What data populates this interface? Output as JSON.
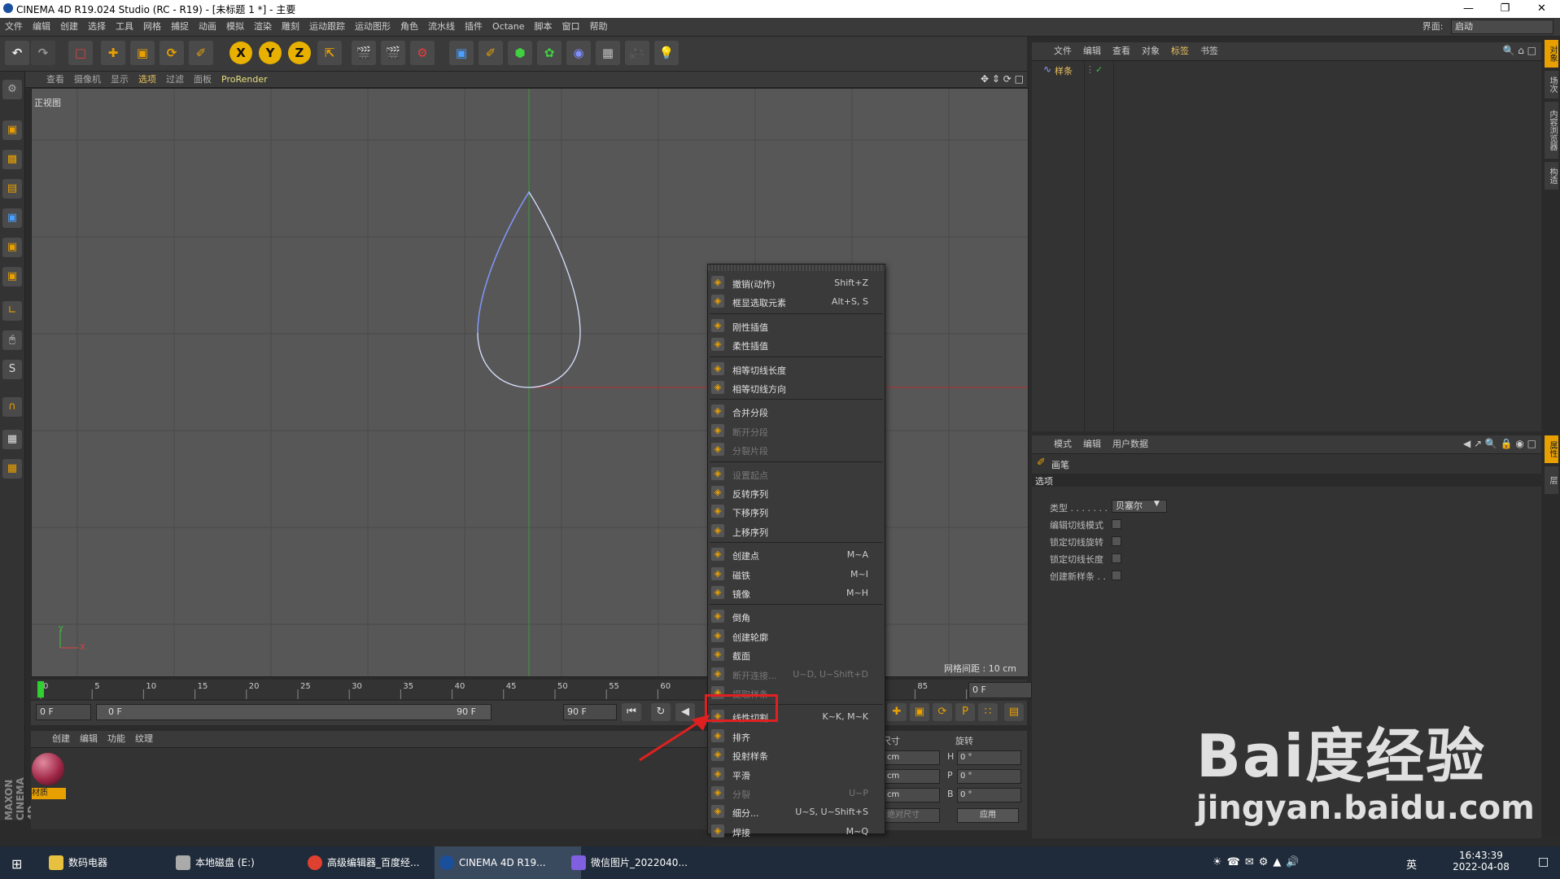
{
  "window": {
    "title": "CINEMA 4D R19.024 Studio (RC - R19) - [未标题 1 *] - 主要",
    "min_icon": "minimize-icon",
    "max_icon": "maximize-icon",
    "close_icon": "close-icon"
  },
  "menubar": {
    "items": [
      "文件",
      "编辑",
      "创建",
      "选择",
      "工具",
      "网格",
      "捕捉",
      "动画",
      "模拟",
      "渲染",
      "雕刻",
      "运动跟踪",
      "运动图形",
      "角色",
      "流水线",
      "插件",
      "Octane",
      "脚本",
      "窗口",
      "帮助"
    ],
    "layout_label": "界面:",
    "layout_value": "启动"
  },
  "toolbar": {
    "axes": [
      "X",
      "Y",
      "Z"
    ]
  },
  "viewport": {
    "menu": [
      "查看",
      "摄像机",
      "显示",
      "选项",
      "过滤",
      "面板",
      "ProRender"
    ],
    "view_name": "正视图",
    "grid_info": "网格间距 : 10 cm",
    "axis_y": "Y",
    "axis_x": "X"
  },
  "timeline": {
    "ticks": [
      "0",
      "5",
      "10",
      "15",
      "20",
      "25",
      "30",
      "35",
      "40",
      "45",
      "50",
      "55",
      "60",
      "65",
      "85",
      "90"
    ],
    "current_frame": "0 F",
    "start": "0 F",
    "range_start": "0 F",
    "range_end": "90 F",
    "end": "90 F"
  },
  "material": {
    "menu": [
      "创建",
      "编辑",
      "功能",
      "纹理"
    ],
    "name": "材质"
  },
  "coords": {
    "size_label": "尺寸",
    "rotation_label": "旋转",
    "rows": [
      {
        "size": "cm",
        "rlabel": "H",
        "rval": "0 °"
      },
      {
        "size": "cm",
        "rlabel": "P",
        "rval": "0 °"
      },
      {
        "size": "cm",
        "rlabel": "B",
        "rval": "0 °"
      }
    ],
    "mode": "绝对尺寸",
    "apply": "应用"
  },
  "object_manager": {
    "menu": [
      "文件",
      "编辑",
      "查看",
      "对象",
      "标签",
      "书签"
    ],
    "object_name": "样条"
  },
  "attributes": {
    "menu": [
      "模式",
      "编辑",
      "用户数据"
    ],
    "tool_name": "画笔",
    "section": "选项",
    "type_label": "类型 . . . . . . .",
    "type_value": "贝塞尔",
    "options": [
      "编辑切线模式",
      "锁定切线旋转",
      "锁定切线长度",
      "创建新样条 . ."
    ]
  },
  "right_strip": [
    "对象",
    "场次",
    "内容浏览器",
    "构造",
    "属性",
    "层"
  ],
  "context_menu": {
    "items": [
      {
        "label": "撤销(动作)",
        "shortcut": "Shift+Z",
        "icon": "undo-icon",
        "disabled": false
      },
      {
        "label": "框显选取元素",
        "shortcut": "Alt+S, S",
        "icon": "frame-selected-icon",
        "disabled": false
      },
      {
        "label": "刚性插值",
        "shortcut": "",
        "icon": "rigid-interpolation-icon",
        "disabled": false
      },
      {
        "label": "柔性插值",
        "shortcut": "",
        "icon": "soft-interpolation-icon",
        "disabled": false
      },
      {
        "label": "相等切线长度",
        "shortcut": "",
        "icon": "equal-tangent-length-icon",
        "disabled": false
      },
      {
        "label": "相等切线方向",
        "shortcut": "",
        "icon": "equal-tangent-direction-icon",
        "disabled": false
      },
      {
        "label": "合并分段",
        "shortcut": "",
        "icon": "join-segment-icon",
        "disabled": false
      },
      {
        "label": "断开分段",
        "shortcut": "",
        "icon": "break-segment-icon",
        "disabled": true
      },
      {
        "label": "分裂片段",
        "shortcut": "",
        "icon": "explode-segments-icon",
        "disabled": true
      },
      {
        "label": "设置起点",
        "shortcut": "",
        "icon": "set-first-point-icon",
        "disabled": true
      },
      {
        "label": "反转序列",
        "shortcut": "",
        "icon": "reverse-sequence-icon",
        "disabled": false
      },
      {
        "label": "下移序列",
        "shortcut": "",
        "icon": "move-down-sequence-icon",
        "disabled": false
      },
      {
        "label": "上移序列",
        "shortcut": "",
        "icon": "move-up-sequence-icon",
        "disabled": false
      },
      {
        "label": "创建点",
        "shortcut": "M~A",
        "icon": "create-point-icon",
        "disabled": false
      },
      {
        "label": "磁铁",
        "shortcut": "M~I",
        "icon": "magnet-icon",
        "disabled": false
      },
      {
        "label": "镜像",
        "shortcut": "M~H",
        "icon": "mirror-icon",
        "disabled": false
      },
      {
        "label": "倒角",
        "shortcut": "",
        "icon": "chamfer-icon",
        "disabled": false
      },
      {
        "label": "创建轮廓",
        "shortcut": "",
        "icon": "create-outline-icon",
        "disabled": false
      },
      {
        "label": "截面",
        "shortcut": "",
        "icon": "cross-section-icon",
        "disabled": false
      },
      {
        "label": "断开连接...",
        "shortcut": "U~D, U~Shift+D",
        "icon": "disconnect-icon",
        "disabled": true
      },
      {
        "label": "提取样条",
        "shortcut": "",
        "icon": "extract-spline-icon",
        "disabled": true
      },
      {
        "label": "线性切割",
        "shortcut": "K~K, M~K",
        "icon": "knife-icon",
        "disabled": false
      },
      {
        "label": "排齐",
        "shortcut": "",
        "icon": "line-up-icon",
        "disabled": false
      },
      {
        "label": "投射样条",
        "shortcut": "",
        "icon": "project-spline-icon",
        "disabled": false
      },
      {
        "label": "平滑",
        "shortcut": "",
        "icon": "smooth-icon",
        "disabled": false
      },
      {
        "label": "分裂",
        "shortcut": "U~P",
        "icon": "split-icon",
        "disabled": true
      },
      {
        "label": "细分...",
        "shortcut": "U~S, U~Shift+S",
        "icon": "subdivide-icon",
        "disabled": false
      },
      {
        "label": "焊接",
        "shortcut": "M~Q",
        "icon": "weld-icon",
        "disabled": false
      }
    ]
  },
  "watermark": {
    "logo": "Bai度经验",
    "url": "jingyan.baidu.com"
  },
  "sidebar_brand": "MAXON CINEMA 4D",
  "taskbar": {
    "tasks": [
      "数码电器",
      "本地磁盘 (E:)",
      "高级编辑器_百度经...",
      "CINEMA 4D R19...",
      "微信图片_2022040..."
    ],
    "ime": "英",
    "time": "16:43:39",
    "date": "2022-04-08"
  }
}
